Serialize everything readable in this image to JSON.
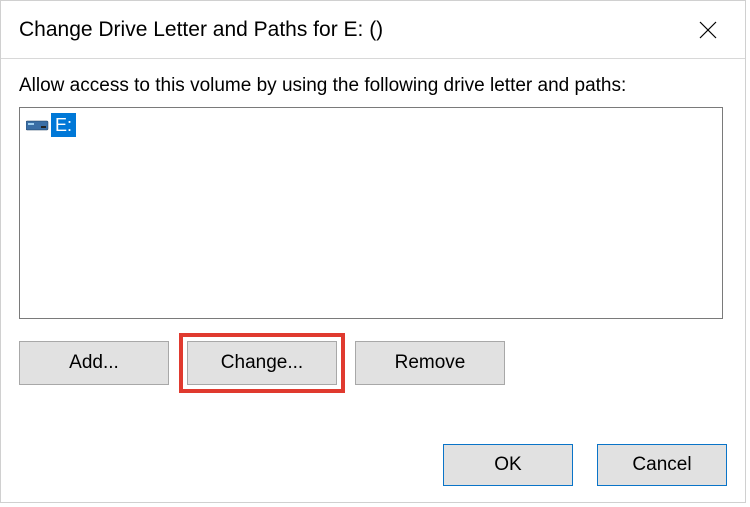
{
  "dialog": {
    "title": "Change Drive Letter and Paths for E: ()",
    "description": "Allow access to this volume by using the following drive letter and paths:",
    "list": {
      "items": [
        {
          "letter": "E:"
        }
      ]
    },
    "buttons": {
      "add": "Add...",
      "change": "Change...",
      "remove": "Remove",
      "ok": "OK",
      "cancel": "Cancel"
    }
  }
}
